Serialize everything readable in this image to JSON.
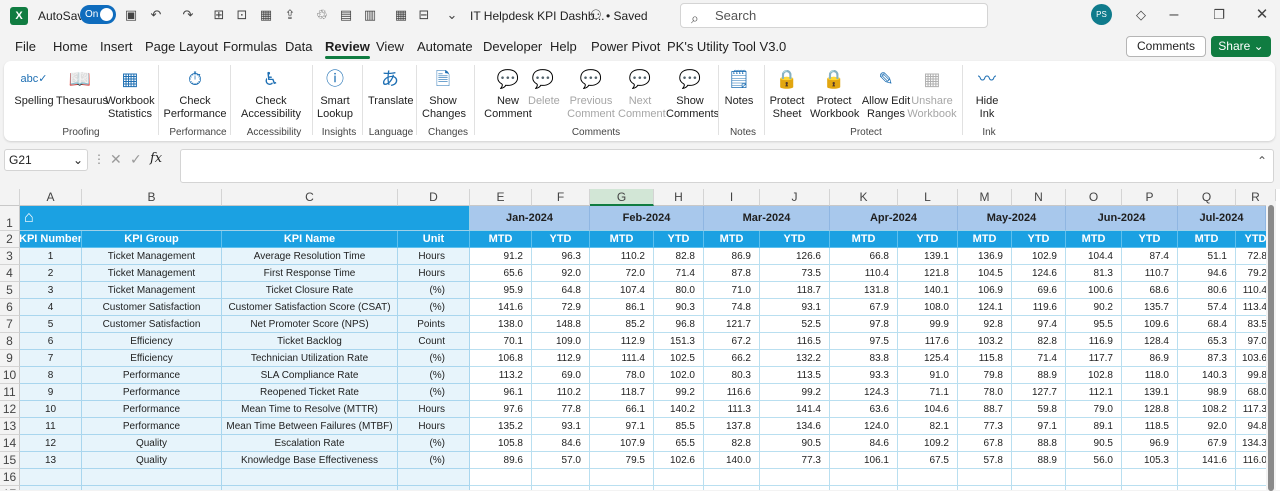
{
  "titlebar": {
    "autosave_label": "AutoSave",
    "autosave_state": "On",
    "file_title": "IT Helpdesk KPI Dashb...",
    "saved_status": "• Saved",
    "search_placeholder": "Search",
    "user_initials": "PS"
  },
  "menu": [
    "File",
    "Home",
    "Insert",
    "Page Layout",
    "Formulas",
    "Data",
    "Review",
    "View",
    "Automate",
    "Developer",
    "Help",
    "Power Pivot",
    "PK's Utility Tool V3.0"
  ],
  "active_tab": "Review",
  "header_buttons": {
    "comments": "Comments",
    "share": "Share"
  },
  "ribbon": {
    "buttons": [
      {
        "label": "Spelling",
        "enabled": true
      },
      {
        "label": "Thesaurus",
        "enabled": true
      },
      {
        "label": "Workbook Statistics",
        "enabled": true
      },
      {
        "label": "Check Performance",
        "enabled": true
      },
      {
        "label": "Check Accessibility",
        "enabled": true
      },
      {
        "label": "Smart Lookup",
        "enabled": true
      },
      {
        "label": "Translate",
        "enabled": true
      },
      {
        "label": "Show Changes",
        "enabled": true
      },
      {
        "label": "New Comment",
        "enabled": true
      },
      {
        "label": "Delete",
        "enabled": false
      },
      {
        "label": "Previous Comment",
        "enabled": false
      },
      {
        "label": "Next Comment",
        "enabled": false
      },
      {
        "label": "Show Comments",
        "enabled": true
      },
      {
        "label": "Notes",
        "enabled": true
      },
      {
        "label": "Protect Sheet",
        "enabled": true
      },
      {
        "label": "Protect Workbook",
        "enabled": true
      },
      {
        "label": "Allow Edit Ranges",
        "enabled": true
      },
      {
        "label": "Unshare Workbook",
        "enabled": false
      },
      {
        "label": "Hide Ink",
        "enabled": true
      }
    ],
    "groups": [
      "Proofing",
      "Performance",
      "Accessibility",
      "Insights",
      "Language",
      "Changes",
      "Comments",
      "Notes",
      "Protect",
      "Ink"
    ]
  },
  "formula_bar": {
    "name_box": "G21",
    "fx": "fx",
    "formula": ""
  },
  "columns": [
    "A",
    "B",
    "C",
    "D",
    "E",
    "F",
    "G",
    "H",
    "I",
    "J",
    "K",
    "L",
    "M",
    "N",
    "O",
    "P",
    "Q",
    "R"
  ],
  "selected_column": "G",
  "row_numbers": [
    "1",
    "2",
    "3",
    "4",
    "5",
    "6",
    "7",
    "8",
    "9",
    "10",
    "11",
    "12",
    "13",
    "14",
    "15",
    "16",
    "17"
  ],
  "months": [
    "Jan-2024",
    "Feb-2024",
    "Mar-2024",
    "Apr-2024",
    "May-2024",
    "Jun-2024",
    "Jul-2024"
  ],
  "table_headers": [
    "KPI Number",
    "KPI Group",
    "KPI Name",
    "Unit"
  ],
  "mtd_label": "MTD",
  "ytd_label": "YTD",
  "rows": [
    {
      "num": "1",
      "group": "Ticket Management",
      "name": "Average Resolution Time",
      "unit": "Hours",
      "vals": [
        "91.2",
        "96.3",
        "110.2",
        "82.8",
        "86.9",
        "126.6",
        "66.8",
        "139.1",
        "136.9",
        "102.9",
        "104.4",
        "87.4",
        "51.1",
        "72.8"
      ]
    },
    {
      "num": "2",
      "group": "Ticket Management",
      "name": "First Response Time",
      "unit": "Hours",
      "vals": [
        "65.6",
        "92.0",
        "72.0",
        "71.4",
        "87.8",
        "73.5",
        "110.4",
        "121.8",
        "104.5",
        "124.6",
        "81.3",
        "110.7",
        "94.6",
        "79.2"
      ]
    },
    {
      "num": "3",
      "group": "Ticket Management",
      "name": "Ticket Closure Rate",
      "unit": "(%)",
      "vals": [
        "95.9",
        "64.8",
        "107.4",
        "80.0",
        "71.0",
        "118.7",
        "131.8",
        "140.1",
        "106.9",
        "69.6",
        "100.6",
        "68.6",
        "80.6",
        "110.4"
      ]
    },
    {
      "num": "4",
      "group": "Customer Satisfaction",
      "name": "Customer Satisfaction Score (CSAT)",
      "unit": "(%)",
      "vals": [
        "141.6",
        "72.9",
        "86.1",
        "90.3",
        "74.8",
        "93.1",
        "67.9",
        "108.0",
        "124.1",
        "119.6",
        "90.2",
        "135.7",
        "57.4",
        "113.4"
      ]
    },
    {
      "num": "5",
      "group": "Customer Satisfaction",
      "name": "Net Promoter Score (NPS)",
      "unit": "Points",
      "vals": [
        "138.0",
        "148.8",
        "85.2",
        "96.8",
        "121.7",
        "52.5",
        "97.8",
        "99.9",
        "92.8",
        "97.4",
        "95.5",
        "109.6",
        "68.4",
        "83.5"
      ]
    },
    {
      "num": "6",
      "group": "Efficiency",
      "name": "Ticket Backlog",
      "unit": "Count",
      "vals": [
        "70.1",
        "109.0",
        "112.9",
        "151.3",
        "67.2",
        "116.5",
        "97.5",
        "117.6",
        "103.2",
        "82.8",
        "116.9",
        "128.4",
        "65.3",
        "97.0"
      ]
    },
    {
      "num": "7",
      "group": "Efficiency",
      "name": "Technician Utilization Rate",
      "unit": "(%)",
      "vals": [
        "106.8",
        "112.9",
        "111.4",
        "102.5",
        "66.2",
        "132.2",
        "83.8",
        "125.4",
        "115.8",
        "71.4",
        "117.7",
        "86.9",
        "87.3",
        "103.6"
      ]
    },
    {
      "num": "8",
      "group": "Performance",
      "name": "SLA Compliance Rate",
      "unit": "(%)",
      "vals": [
        "113.2",
        "69.0",
        "78.0",
        "102.0",
        "80.3",
        "113.5",
        "93.3",
        "91.0",
        "79.8",
        "88.9",
        "102.8",
        "118.0",
        "140.3",
        "99.8"
      ]
    },
    {
      "num": "9",
      "group": "Performance",
      "name": "Reopened Ticket Rate",
      "unit": "(%)",
      "vals": [
        "96.1",
        "110.2",
        "118.7",
        "99.2",
        "116.6",
        "99.2",
        "124.3",
        "71.1",
        "78.0",
        "127.7",
        "112.1",
        "139.1",
        "98.9",
        "68.0"
      ]
    },
    {
      "num": "10",
      "group": "Performance",
      "name": "Mean Time to Resolve (MTTR)",
      "unit": "Hours",
      "vals": [
        "97.6",
        "77.8",
        "66.1",
        "140.2",
        "111.3",
        "141.4",
        "63.6",
        "104.6",
        "88.7",
        "59.8",
        "79.0",
        "128.8",
        "108.2",
        "117.3"
      ]
    },
    {
      "num": "11",
      "group": "Performance",
      "name": "Mean Time Between Failures (MTBF)",
      "unit": "Hours",
      "vals": [
        "135.2",
        "93.1",
        "97.1",
        "85.5",
        "137.8",
        "134.6",
        "124.0",
        "82.1",
        "77.3",
        "97.1",
        "89.1",
        "118.5",
        "92.0",
        "94.8"
      ]
    },
    {
      "num": "12",
      "group": "Quality",
      "name": "Escalation Rate",
      "unit": "(%)",
      "vals": [
        "105.8",
        "84.6",
        "107.9",
        "65.5",
        "82.8",
        "90.5",
        "84.6",
        "109.2",
        "67.8",
        "88.8",
        "90.5",
        "96.9",
        "67.9",
        "134.3"
      ]
    },
    {
      "num": "13",
      "group": "Quality",
      "name": "Knowledge Base Effectiveness",
      "unit": "(%)",
      "vals": [
        "89.6",
        "57.0",
        "79.5",
        "102.6",
        "140.0",
        "77.3",
        "106.1",
        "67.5",
        "57.8",
        "88.9",
        "56.0",
        "105.3",
        "141.6",
        "116.0"
      ]
    }
  ]
}
